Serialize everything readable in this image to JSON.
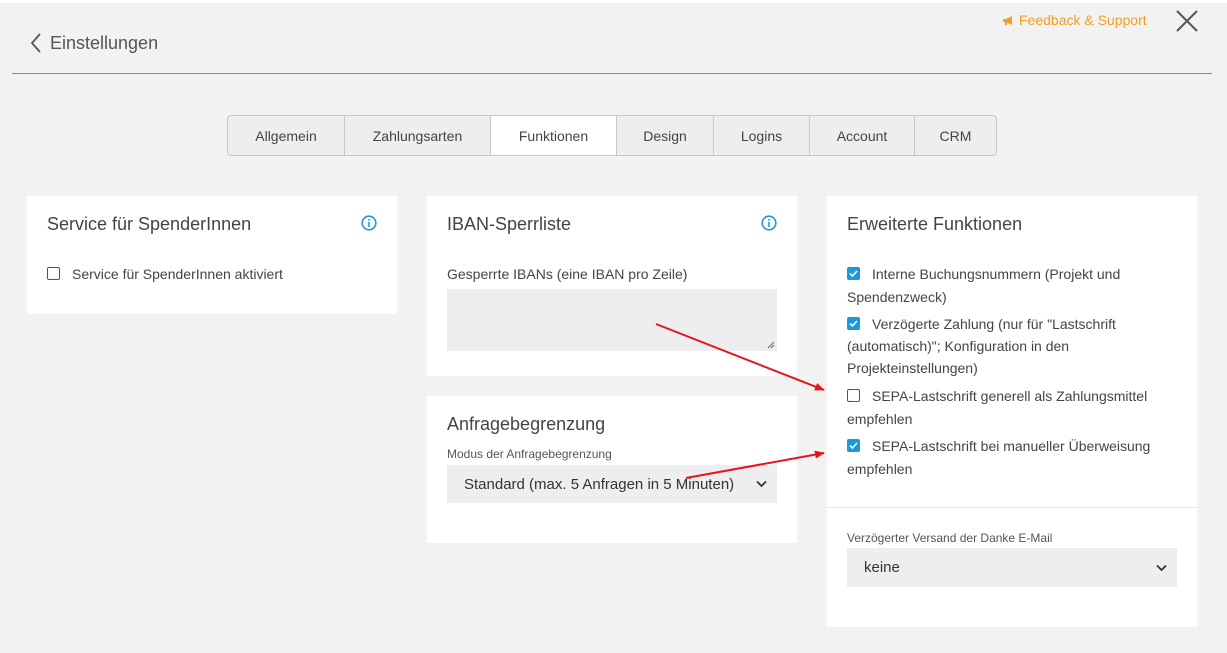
{
  "header": {
    "back_label": "Einstellungen",
    "feedback_label": "Feedback & Support"
  },
  "tabs": [
    {
      "label": "Allgemein",
      "active": false
    },
    {
      "label": "Zahlungsarten",
      "active": false
    },
    {
      "label": "Funktionen",
      "active": true
    },
    {
      "label": "Design",
      "active": false
    },
    {
      "label": "Logins",
      "active": false
    },
    {
      "label": "Account",
      "active": false
    },
    {
      "label": "CRM",
      "active": false
    }
  ],
  "service_card": {
    "title": "Service für SpenderInnen",
    "checkbox": {
      "label": "Service für SpenderInnen aktiviert",
      "checked": false
    }
  },
  "iban_card": {
    "title": "IBAN-Sperrliste",
    "field_label": "Gesperrte IBANs (eine IBAN pro Zeile)",
    "value": ""
  },
  "rate_card": {
    "title": "Anfragebegrenzung",
    "select_label": "Modus der Anfragebegrenzung",
    "select_value": "Standard (max. 5 Anfragen in 5 Minuten)"
  },
  "extended_card": {
    "title": "Erweiterte Funktionen",
    "options": [
      {
        "label": "Interne Buchungsnummern (Projekt und Spendenzweck)",
        "checked": true
      },
      {
        "label": "Verzögerte Zahlung (nur für \"Lastschrift (automatisch)\"; Konfiguration in den Projekteinstellungen)",
        "checked": true
      },
      {
        "label": "SEPA-Lastschrift generell als Zahlungsmittel empfehlen",
        "checked": false
      },
      {
        "label": "SEPA-Lastschrift bei manueller Überweisung empfehlen",
        "checked": true
      }
    ],
    "email_delay_label": "Verzögerter Versand der Danke E-Mail",
    "email_delay_value": "keine"
  },
  "colors": {
    "accent": "#1a9ad6",
    "feedback": "#f0a020",
    "annotation_arrow": "#e8141c"
  }
}
